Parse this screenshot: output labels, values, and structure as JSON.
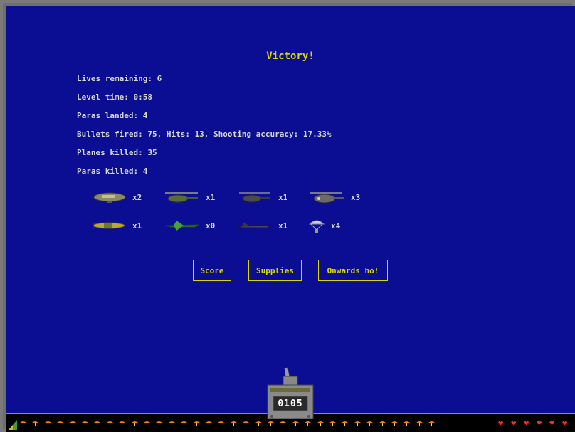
{
  "title": "Victory!",
  "stats": {
    "lives": "Lives remaining: 6",
    "level_time": "Level time: 0:58",
    "paras_landed": "Paras landed: 4",
    "bullets": "Bullets fired: 75, Hits: 13, Shooting accuracy: 17.33%",
    "planes_killed": "Planes killed: 35",
    "paras_killed": "Paras killed: 4"
  },
  "kills": [
    {
      "icon": "blimp-icon",
      "count": "x2"
    },
    {
      "icon": "attack-helicopter-icon",
      "count": "x1"
    },
    {
      "icon": "helicopter-icon",
      "count": "x1"
    },
    {
      "icon": "gunship-helicopter-icon",
      "count": "x3"
    },
    {
      "icon": "propeller-plane-icon",
      "count": "x1"
    },
    {
      "icon": "jet-fighter-icon",
      "count": "x0"
    },
    {
      "icon": "stealth-jet-icon",
      "count": "x1"
    },
    {
      "icon": "paratrooper-icon",
      "count": "x4"
    }
  ],
  "buttons": {
    "score": "Score",
    "supplies": "Supplies",
    "onwards": "Onwards ho!"
  },
  "hud": {
    "score": "0105",
    "parachutes": 34,
    "hearts": 6,
    "ammo_icon": "ammo-gauge-icon"
  },
  "colors": {
    "background": "#0b0d93",
    "title": "#d8d800",
    "text": "#d6d6d6",
    "heart": "#ff2a2a"
  }
}
